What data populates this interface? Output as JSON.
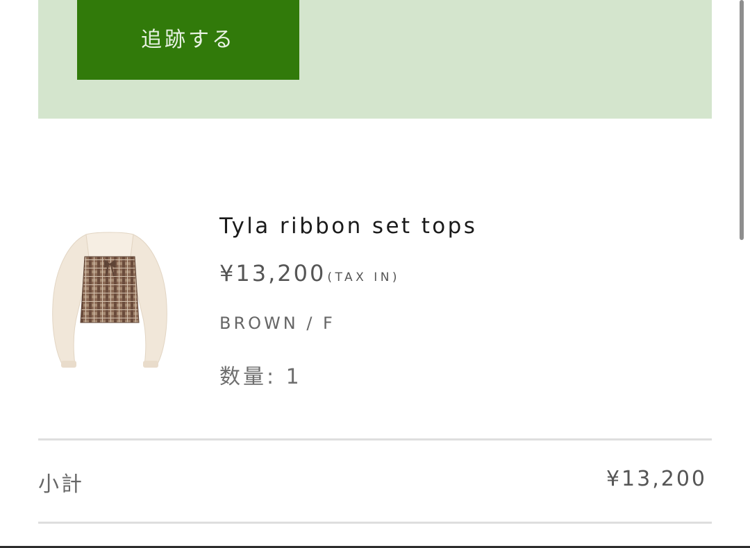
{
  "tracking": {
    "button_label": "追跡する"
  },
  "cart_item": {
    "name": "Tyla ribbon set tops",
    "price": "¥13,200",
    "tax_note": "(TAX IN)",
    "variant": "BROWN / F",
    "quantity": "数量: 1",
    "image_icon": "product-photo-cardigan-plaid-top"
  },
  "summary": {
    "subtotal_label": "小計",
    "subtotal_value": "¥13,200"
  },
  "colors": {
    "panel_bg": "#d4e5cd",
    "button_bg": "#317a0a",
    "button_text": "#e9f3e4",
    "divider": "#dedede"
  }
}
